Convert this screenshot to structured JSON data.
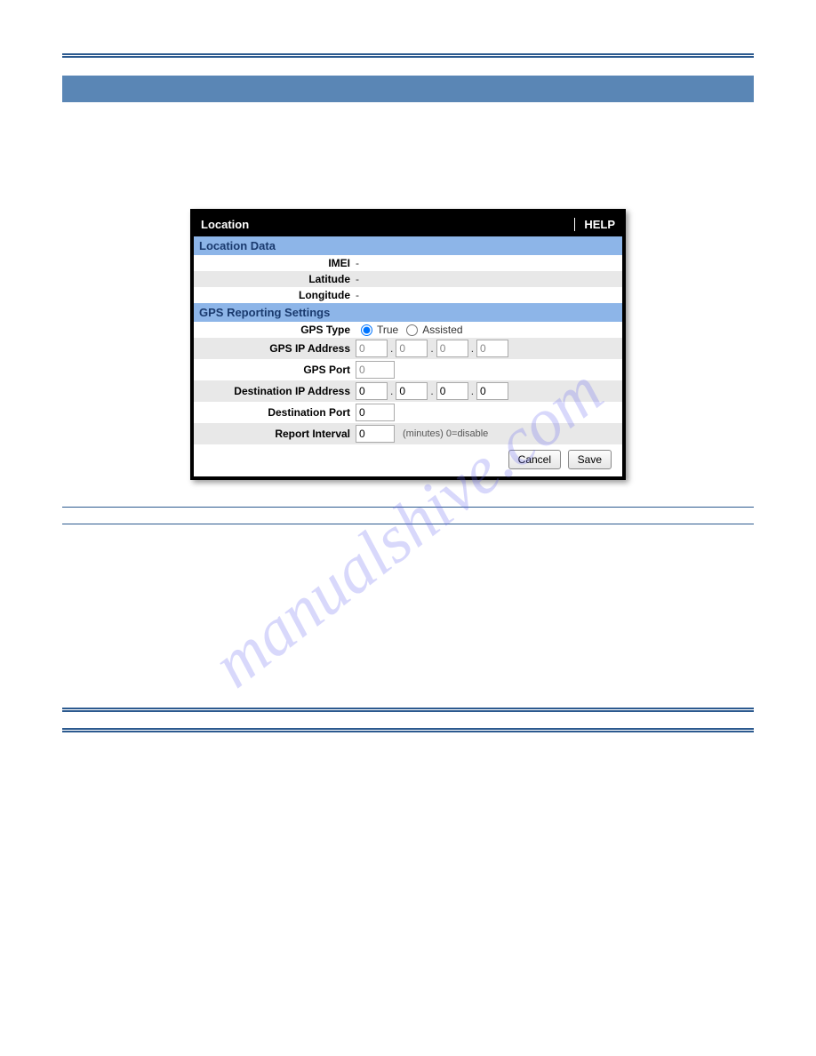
{
  "watermark": "manualshive.com",
  "panel": {
    "title": "Location",
    "help": "HELP",
    "section1": "Location Data",
    "imei_label": "IMEI",
    "imei_value": "-",
    "lat_label": "Latitude",
    "lat_value": "-",
    "lon_label": "Longitude",
    "lon_value": "-",
    "section2": "GPS Reporting Settings",
    "gps_type_label": "GPS Type",
    "gps_type_true": "True",
    "gps_type_assisted": "Assisted",
    "gps_ip_label": "GPS IP Address",
    "gps_ip": [
      "0",
      "0",
      "0",
      "0"
    ],
    "gps_port_label": "GPS Port",
    "gps_port": "0",
    "dest_ip_label": "Destination IP Address",
    "dest_ip": [
      "0",
      "0",
      "0",
      "0"
    ],
    "dest_port_label": "Destination Port",
    "dest_port": "0",
    "interval_label": "Report Interval",
    "interval_value": "0",
    "interval_hint": "(minutes) 0=disable",
    "cancel": "Cancel",
    "save": "Save"
  }
}
